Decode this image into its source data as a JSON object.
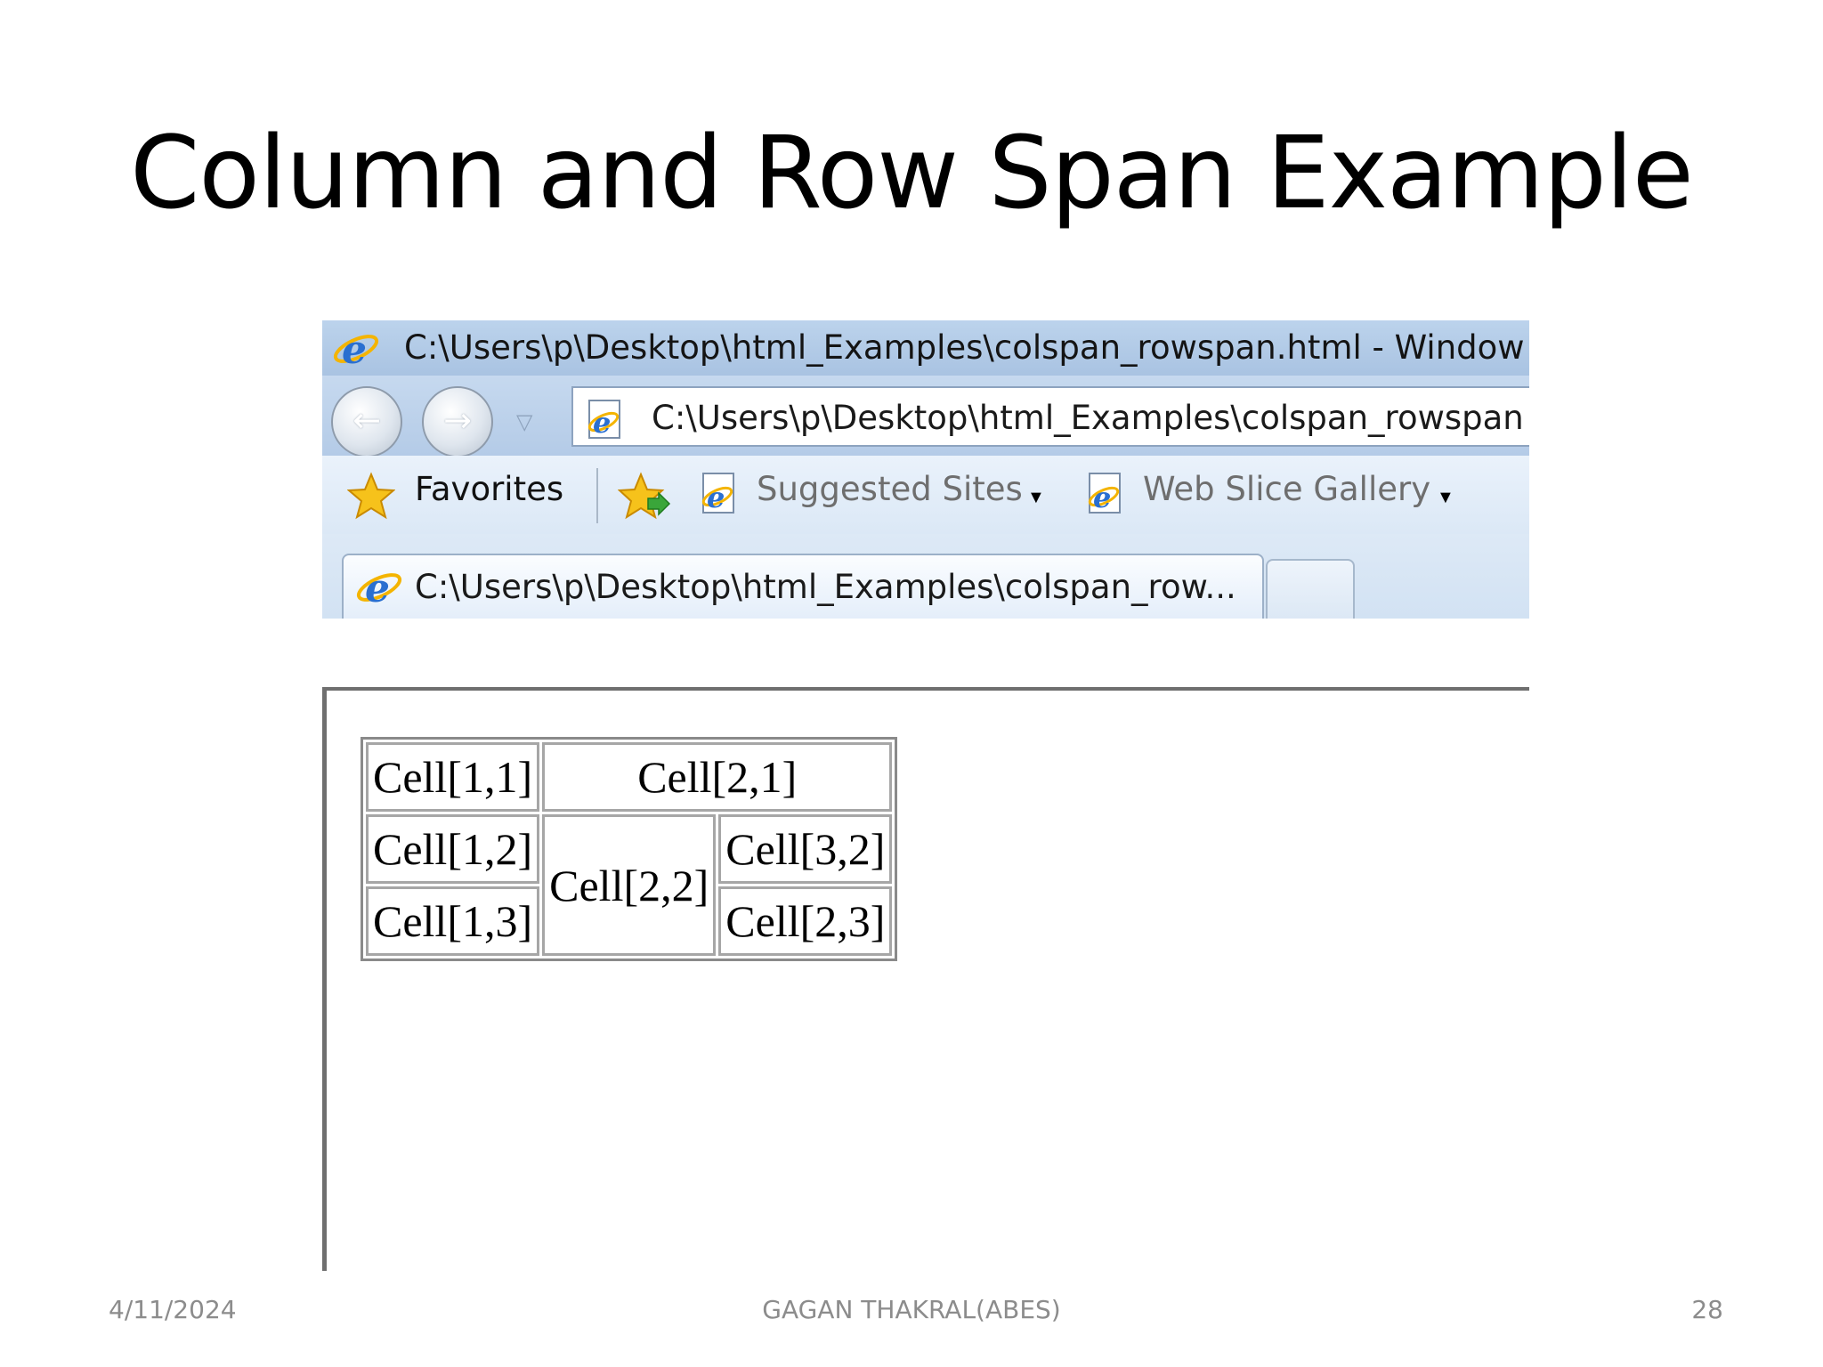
{
  "slide": {
    "title": "Column and Row Span Example",
    "footer": {
      "date": "4/11/2024",
      "author": "GAGAN THAKRAL(ABES)",
      "page": "28"
    }
  },
  "browser": {
    "window_title": "C:\\Users\\p\\Desktop\\html_Examples\\colspan_rowspan.html - Window",
    "address": "C:\\Users\\p\\Desktop\\html_Examples\\colspan_rowspan",
    "nav": {
      "back_icon": "back-arrow-icon",
      "forward_icon": "forward-arrow-icon"
    },
    "favorites_bar": {
      "favorites_label": "Favorites",
      "suggested_sites_label": "Suggested Sites",
      "web_slice_label": "Web Slice Gallery"
    },
    "tab": {
      "label": "C:\\Users\\p\\Desktop\\html_Examples\\colspan_row..."
    }
  },
  "table": {
    "r1c1": "Cell[1,1]",
    "r1c2": "Cell[2,1]",
    "r2c1": "Cell[1,2]",
    "r2c2": "Cell[2,2]",
    "r2c3": "Cell[3,2]",
    "r3c1": "Cell[1,3]",
    "r3c3": "Cell[2,3]"
  },
  "colors": {
    "titlebar": "#bcd3ec",
    "ie_blue": "#2a6fd0",
    "ie_ring": "#f4b400"
  }
}
